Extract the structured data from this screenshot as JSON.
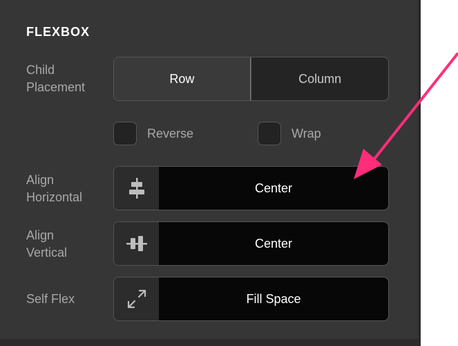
{
  "section": {
    "title": "FLEXBOX"
  },
  "child_placement": {
    "label_line1": "Child",
    "label_line2": "Placement",
    "options": [
      "Row",
      "Column"
    ],
    "selected": "Row"
  },
  "checkboxes": {
    "reverse": {
      "label": "Reverse",
      "checked": false
    },
    "wrap": {
      "label": "Wrap",
      "checked": false
    }
  },
  "align_horizontal": {
    "label_line1": "Align",
    "label_line2": "Horizontal",
    "icon": "align-horizontal-center-icon",
    "value": "Center"
  },
  "align_vertical": {
    "label_line1": "Align",
    "label_line2": "Vertical",
    "icon": "align-vertical-center-icon",
    "value": "Center"
  },
  "self_flex": {
    "label": "Self Flex",
    "icon": "expand-arrows-icon",
    "value": "Fill Space"
  },
  "colors": {
    "panel": "#363636",
    "annotation_arrow": "#ff2d7a"
  }
}
